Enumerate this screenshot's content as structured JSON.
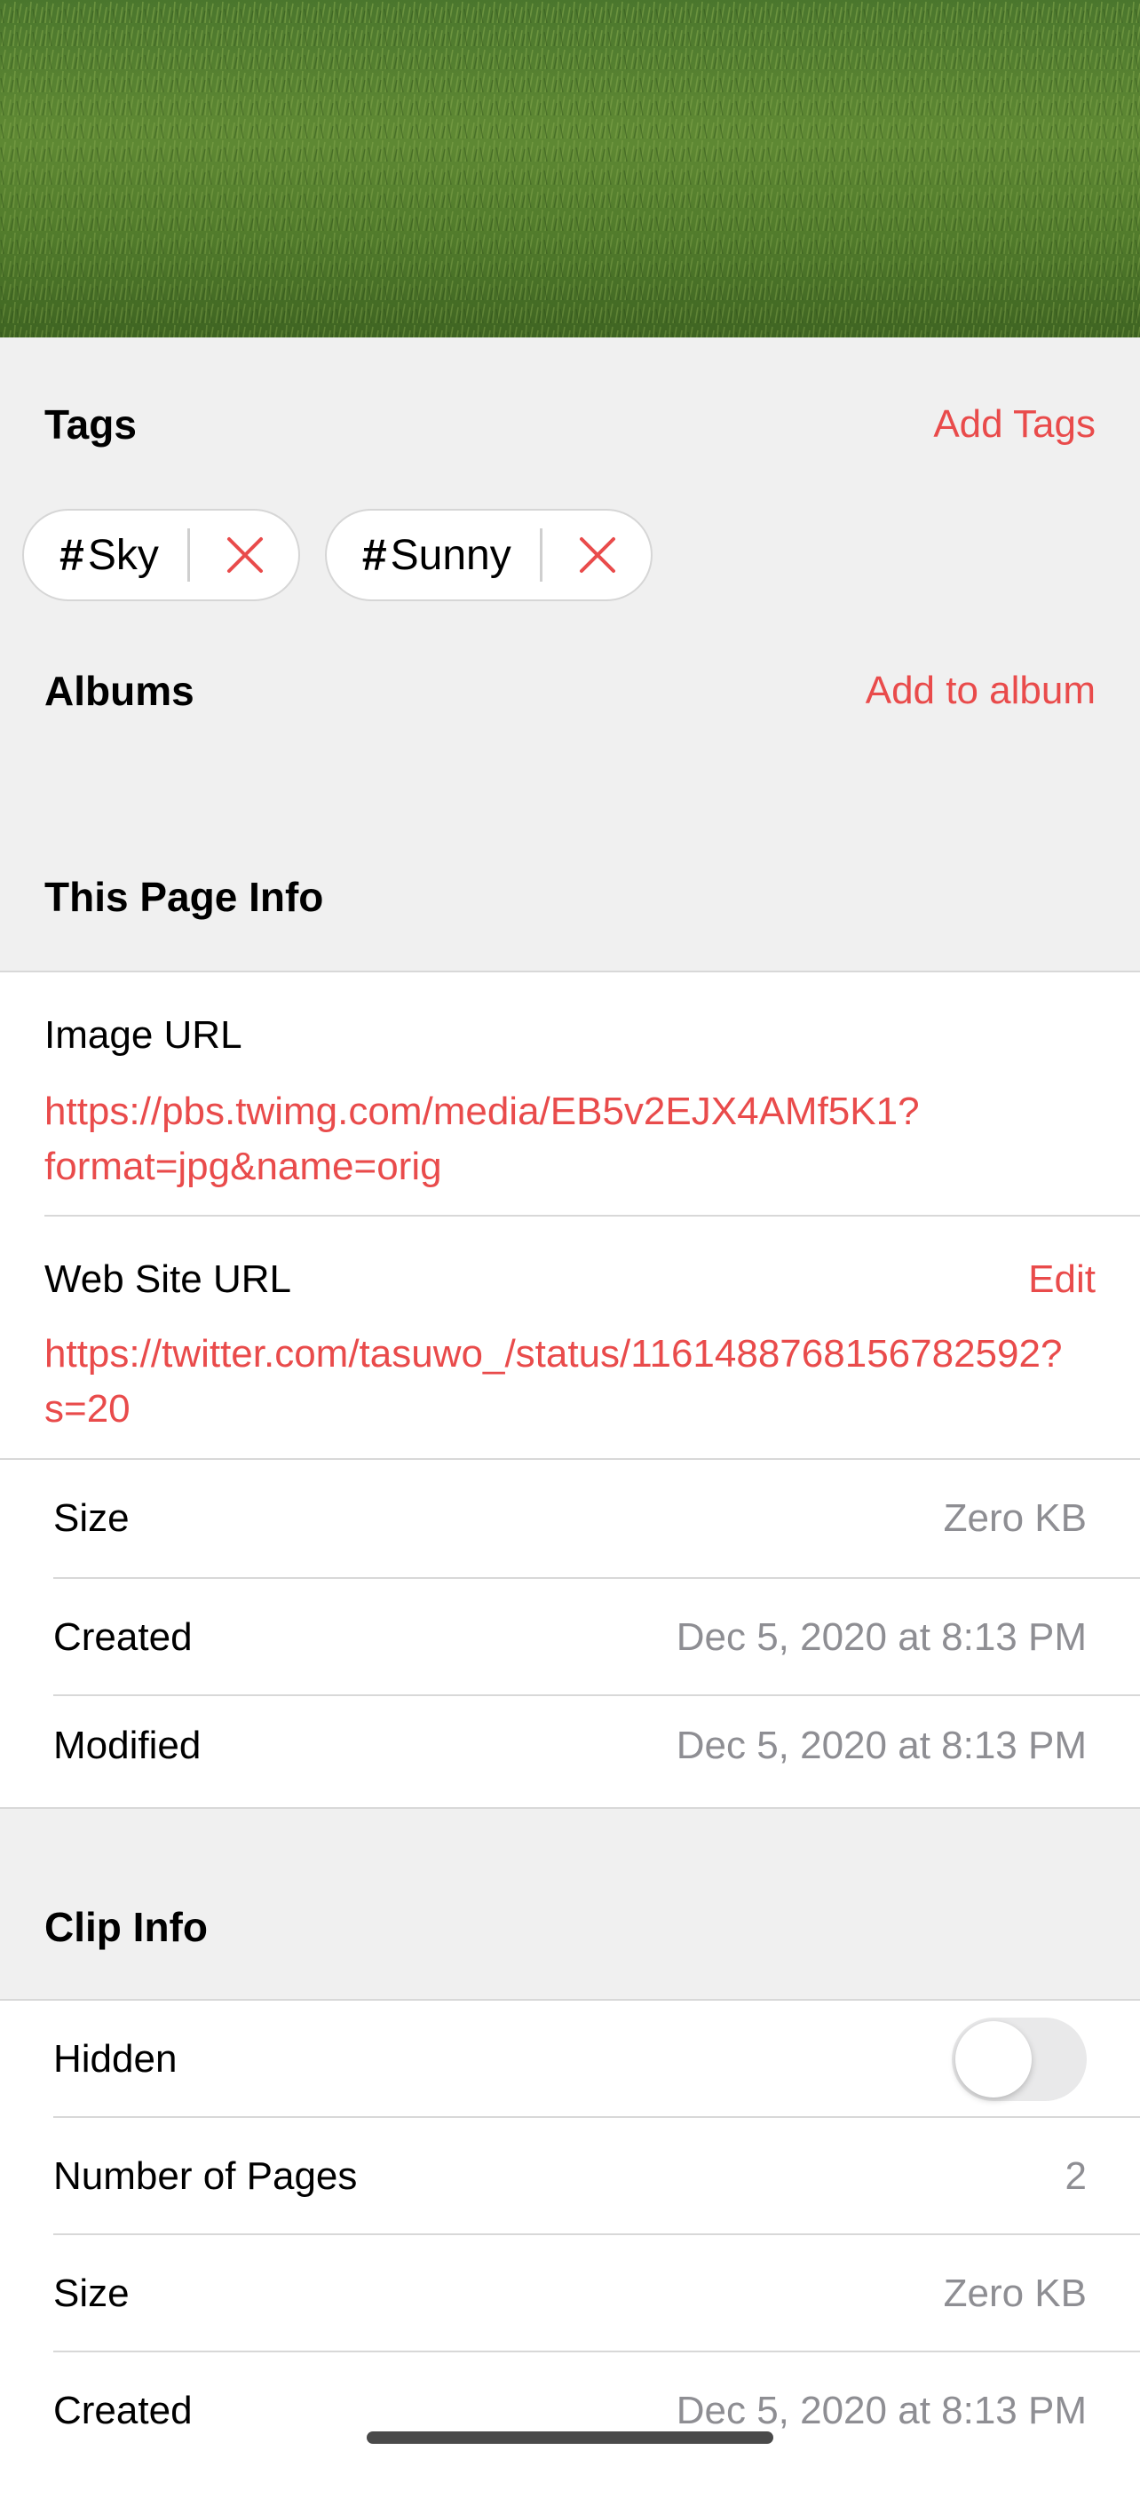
{
  "tags_section": {
    "title": "Tags",
    "action": "Add Tags",
    "chips": [
      {
        "hash": "#",
        "label": "Sky"
      },
      {
        "hash": "#",
        "label": "Sunny"
      }
    ]
  },
  "albums_section": {
    "title": "Albums",
    "action": "Add to album"
  },
  "page_info": {
    "title": "This Page Info",
    "image_url_label": "Image URL",
    "image_url_value": "https://pbs.twimg.com/media/EB5v2EJX4AMf5K1?format=jpg&name=orig",
    "website_url_label": "Web Site URL",
    "website_url_edit": "Edit",
    "website_url_value": "https://twitter.com/tasuwo_/status/1161488768156782592?s=20",
    "rows": [
      {
        "label": "Size",
        "value": "Zero KB"
      },
      {
        "label": "Created",
        "value": "Dec 5, 2020 at 8:13 PM"
      },
      {
        "label": "Modified",
        "value": "Dec 5, 2020 at 8:13 PM"
      }
    ]
  },
  "clip_info": {
    "title": "Clip Info",
    "hidden_label": "Hidden",
    "hidden_on": false,
    "rows": [
      {
        "label": "Number of Pages",
        "value": "2"
      },
      {
        "label": "Size",
        "value": "Zero KB"
      },
      {
        "label": "Created",
        "value": "Dec 5, 2020 at 8:13 PM"
      }
    ]
  },
  "colors": {
    "accent": "#e94b4b",
    "grouped_background": "#f0f0f0",
    "secondary_text": "#8e8e93"
  }
}
